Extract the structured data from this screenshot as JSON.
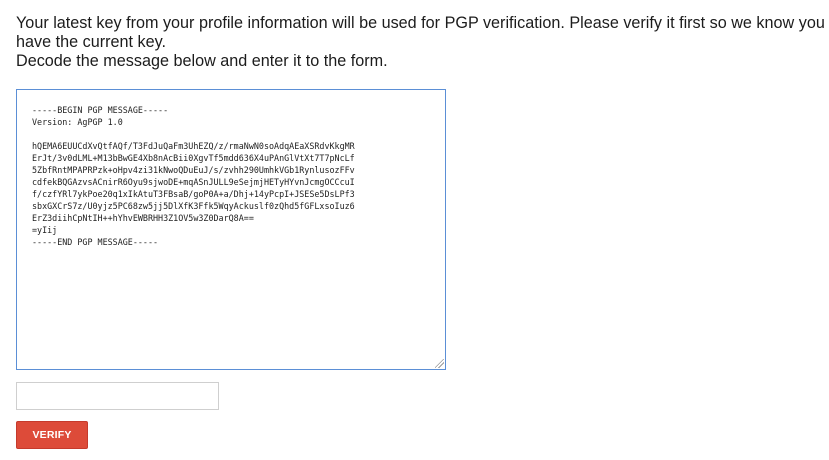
{
  "instructions": {
    "line1": "Your latest key from your profile information will be used for PGP verification. Please verify it first so we know you have the current key.",
    "line2": "Decode the message below and enter it to the form."
  },
  "pgp_message": {
    "lines": [
      "-----BEGIN PGP MESSAGE-----",
      "Version: AgPGP 1.0",
      "",
      "hQEMA6EUUCdXvQtfAQf/T3FdJuQaFm3UhEZQ/z/rmaNwN0soAdqAEaXSRdvKkgMR",
      "ErJt/3v0dLML+M13bBwGE4Xb8nAcBii0XgvTf5mdd636X4uPAnGlVtXt7T7pNcLf",
      "5ZbfRntMPAPRPzk+oHpv4zi31kNwoQDuEuJ/s/zvhh290UmhkVGb1RynlusozFFv",
      "cdfekBQGAzvsACnirR6Oyu9sjwoDE+mqASnJULL9eSejmjHETyHYvnJcmgOCCcuI",
      "f/czfYRl7ykPoe20q1xIkAtuT3FBsaB/goP0A+a/Dhj+14yPcpI+JSESe5DsLPf3",
      "sbxGXCrS7z/U0yjz5PC68zw5jj5DlXfK3Ffk5WqyAckuslf0zQhd5fGFLxsoIuz6",
      "ErZ3diihCpNtIH++hYhvEWBRHH3Z1OV5w3Z0DarQ8A==",
      "=yIij",
      "-----END PGP MESSAGE-----"
    ]
  },
  "code_input": {
    "value": "",
    "placeholder": ""
  },
  "verify_button": {
    "label": "VERIFY"
  },
  "colors": {
    "button_bg": "#dd4b39",
    "textarea_border": "#5b8fd6"
  }
}
